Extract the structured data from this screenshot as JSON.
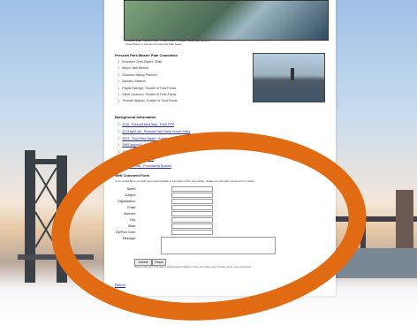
{
  "map_caption": {
    "line1": "Prescott Park - Master Plan - Project Area (includes highlighted parcels)",
    "line2": "Assemblage of Parcels and General Park Areas"
  },
  "committee": {
    "title": "Prescott Park Master Plan Committee",
    "members": [
      "Councilor Chris Dwyer, Chair",
      "Mayor Jack Blalock",
      "Councilor Nancy Pearson",
      "Zachary Gleason",
      "Phyllis Eldridge, Trustee of Trust Funds",
      "Steve Lessoum, Trustee of Trust Funds",
      "Thomas Watson, Trustee of Trust Funds"
    ]
  },
  "background": {
    "title": "Background Information",
    "links": [
      "2016 - Prescott Area Map - Form RFP",
      "2013 April 4th - Prescott Park Public Forum Policy",
      "1974 - Trust Fees Award - Environment Plan Attached",
      "1965 August 6 - Report on the Acquisition...",
      "1964 - Prescott Park ...",
      "1964 - Prescott Park ...",
      "Prescott Park - Promotional Booklet"
    ]
  },
  "comment_form": {
    "title": "Web Comment Form",
    "intro": "If you would like to provide input electronically to members of the Committee, please use this web comment form below:",
    "fields": [
      "Name:",
      "Subject:",
      "Organization:",
      "Email:",
      "Address:",
      "City:",
      "State:",
      "Zip/Post Code:"
    ],
    "message_label": "Message:",
    "submit_label": "Submit",
    "reset_label": "Reset",
    "note": "Please note your information will be shared publicly on the Committee page. Thank you for your comments."
  },
  "footer": {
    "return_link": "Return"
  },
  "colors": {
    "highlight_oval": "#e06b12",
    "link": "#2222aa"
  }
}
